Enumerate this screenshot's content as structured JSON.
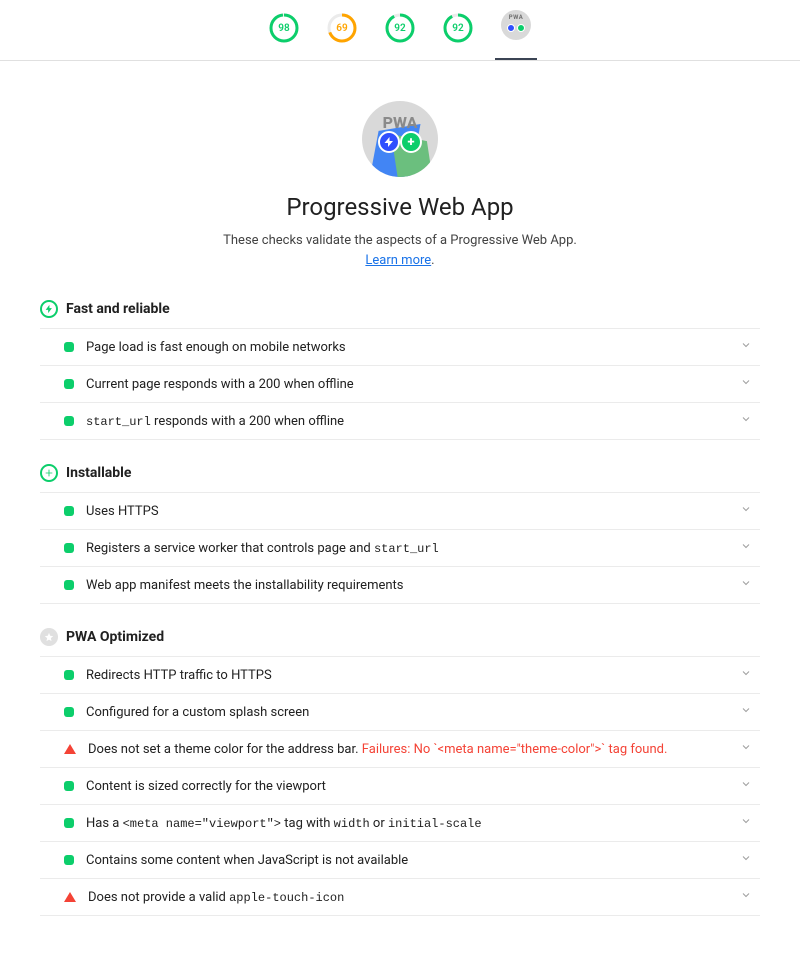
{
  "topbar": {
    "gauges": [
      {
        "value": "98",
        "pct": 98,
        "color": "green"
      },
      {
        "value": "69",
        "pct": 69,
        "color": "orange"
      },
      {
        "value": "92",
        "pct": 92,
        "color": "green"
      },
      {
        "value": "92",
        "pct": 92,
        "color": "green"
      }
    ],
    "pwa_label": "PWA"
  },
  "header": {
    "badge_label": "PWA",
    "title": "Progressive Web App",
    "subtitle_pre": "These checks validate the aspects of a Progressive Web App. ",
    "learn_more": "Learn more"
  },
  "sections": [
    {
      "id": "fast",
      "icon": "bolt",
      "title": "Fast and reliable",
      "audits": [
        {
          "status": "pass",
          "segments": [
            {
              "t": "text",
              "v": "Page load is fast enough on mobile networks"
            }
          ]
        },
        {
          "status": "pass",
          "segments": [
            {
              "t": "text",
              "v": "Current page responds with a 200 when offline"
            }
          ]
        },
        {
          "status": "pass",
          "segments": [
            {
              "t": "code",
              "v": "start_url"
            },
            {
              "t": "text",
              "v": " responds with a 200 when offline"
            }
          ]
        }
      ]
    },
    {
      "id": "installable",
      "icon": "plus",
      "title": "Installable",
      "audits": [
        {
          "status": "pass",
          "segments": [
            {
              "t": "text",
              "v": "Uses HTTPS"
            }
          ]
        },
        {
          "status": "pass",
          "segments": [
            {
              "t": "text",
              "v": "Registers a service worker that controls page and "
            },
            {
              "t": "code",
              "v": "start_url"
            }
          ]
        },
        {
          "status": "pass",
          "segments": [
            {
              "t": "text",
              "v": "Web app manifest meets the installability requirements"
            }
          ]
        }
      ]
    },
    {
      "id": "optimized",
      "icon": "star-grey",
      "title": "PWA Optimized",
      "audits": [
        {
          "status": "pass",
          "segments": [
            {
              "t": "text",
              "v": "Redirects HTTP traffic to HTTPS"
            }
          ]
        },
        {
          "status": "pass",
          "segments": [
            {
              "t": "text",
              "v": "Configured for a custom splash screen"
            }
          ]
        },
        {
          "status": "fail",
          "segments": [
            {
              "t": "text",
              "v": "Does not set a theme color for the address bar. "
            },
            {
              "t": "fail",
              "v": "Failures: No `<meta name=\"theme-color\">` tag found."
            }
          ]
        },
        {
          "status": "pass",
          "segments": [
            {
              "t": "text",
              "v": "Content is sized correctly for the viewport"
            }
          ]
        },
        {
          "status": "pass",
          "segments": [
            {
              "t": "text",
              "v": "Has a "
            },
            {
              "t": "code",
              "v": "<meta name=\"viewport\">"
            },
            {
              "t": "text",
              "v": " tag with "
            },
            {
              "t": "code",
              "v": "width"
            },
            {
              "t": "text",
              "v": " or "
            },
            {
              "t": "code",
              "v": "initial-scale"
            }
          ]
        },
        {
          "status": "pass",
          "segments": [
            {
              "t": "text",
              "v": "Contains some content when JavaScript is not available"
            }
          ]
        },
        {
          "status": "fail",
          "segments": [
            {
              "t": "text",
              "v": "Does not provide a valid "
            },
            {
              "t": "code",
              "v": "apple-touch-icon"
            }
          ]
        }
      ]
    }
  ]
}
